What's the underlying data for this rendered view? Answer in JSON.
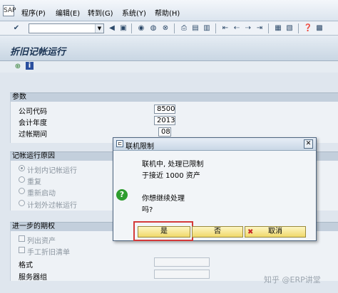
{
  "menubar": {
    "app_icon_label": "SAP",
    "items": [
      "程序(P)",
      "编辑(E)",
      "转到(G)",
      "系统(Y)",
      "帮助(H)"
    ]
  },
  "toolbar": {
    "command_value": "",
    "dropdown_glyph": "▼",
    "icons": [
      "enter-icon",
      "back-icon",
      "save-icon",
      "back-nav-icon",
      "exit-icon",
      "cancel-icon",
      "print-icon",
      "find-icon",
      "find-next-icon",
      "first-page-icon",
      "prev-page-icon",
      "next-page-icon",
      "last-page-icon",
      "new-session-icon",
      "shortcut-icon",
      "help-icon",
      "layout-icon"
    ]
  },
  "screen": {
    "title": "折旧记帐运行",
    "execute_icon": "execute-icon",
    "info_icon": "info-icon"
  },
  "params": {
    "header": "参数",
    "company_code_label": "公司代码",
    "company_code": "8500",
    "fiscal_year_label": "会计年度",
    "fiscal_year": "2013",
    "period_label": "过帐期间",
    "period": "08"
  },
  "reason": {
    "header": "记帐运行原因",
    "options": [
      "计划内记帐运行",
      "重复",
      "重新启动",
      "计划外过帐运行"
    ]
  },
  "further": {
    "header": "进一步的期权",
    "options": [
      "列出资产",
      "手工折旧清单"
    ],
    "layout_label": "格式",
    "server_group_label": "服务器组"
  },
  "dialog": {
    "title": "联机限制",
    "line1": "联机中, 处理已限制",
    "line2": "于接近 1000 资产",
    "question1": "你想继续处理",
    "question2": "吗?",
    "yes_label": "是",
    "no_label": "否",
    "cancel_label": "取消",
    "close_glyph": "✕",
    "question_glyph": "?"
  },
  "watermark": "知乎 @ERP讲堂",
  "colors": {
    "accent_highlight": "#d43a3a",
    "button_yellow": "#f0d96a",
    "title_blue": "#1b3454"
  }
}
